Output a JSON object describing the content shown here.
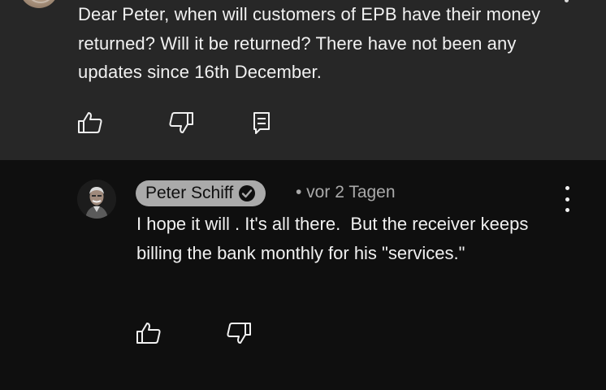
{
  "parent_comment": {
    "text": "Dear Peter, when will customers of EPB have their money returned? Will it be returned? There have not been any updates since 16th December.",
    "actions": {
      "like_icon": "thumbs-up-icon",
      "dislike_icon": "thumbs-down-icon",
      "reply_icon": "reply-icon"
    }
  },
  "reply": {
    "author": "Peter Schiff",
    "verified_icon": "verified-check-icon",
    "meta": "• vor 2 Tagen",
    "text": "I hope it will . It's all there.  But the receiver keeps billing the bank monthly for his \"services.\"",
    "menu_icon": "more-vert-icon",
    "actions": {
      "like_icon": "thumbs-up-icon",
      "dislike_icon": "thumbs-down-icon"
    }
  },
  "colors": {
    "parent_background": "#272727",
    "page_background": "#0f0f0f",
    "author_chip": "#aaaaaa",
    "text": "#f1f1f1",
    "secondary_text": "#aaaaaa"
  }
}
